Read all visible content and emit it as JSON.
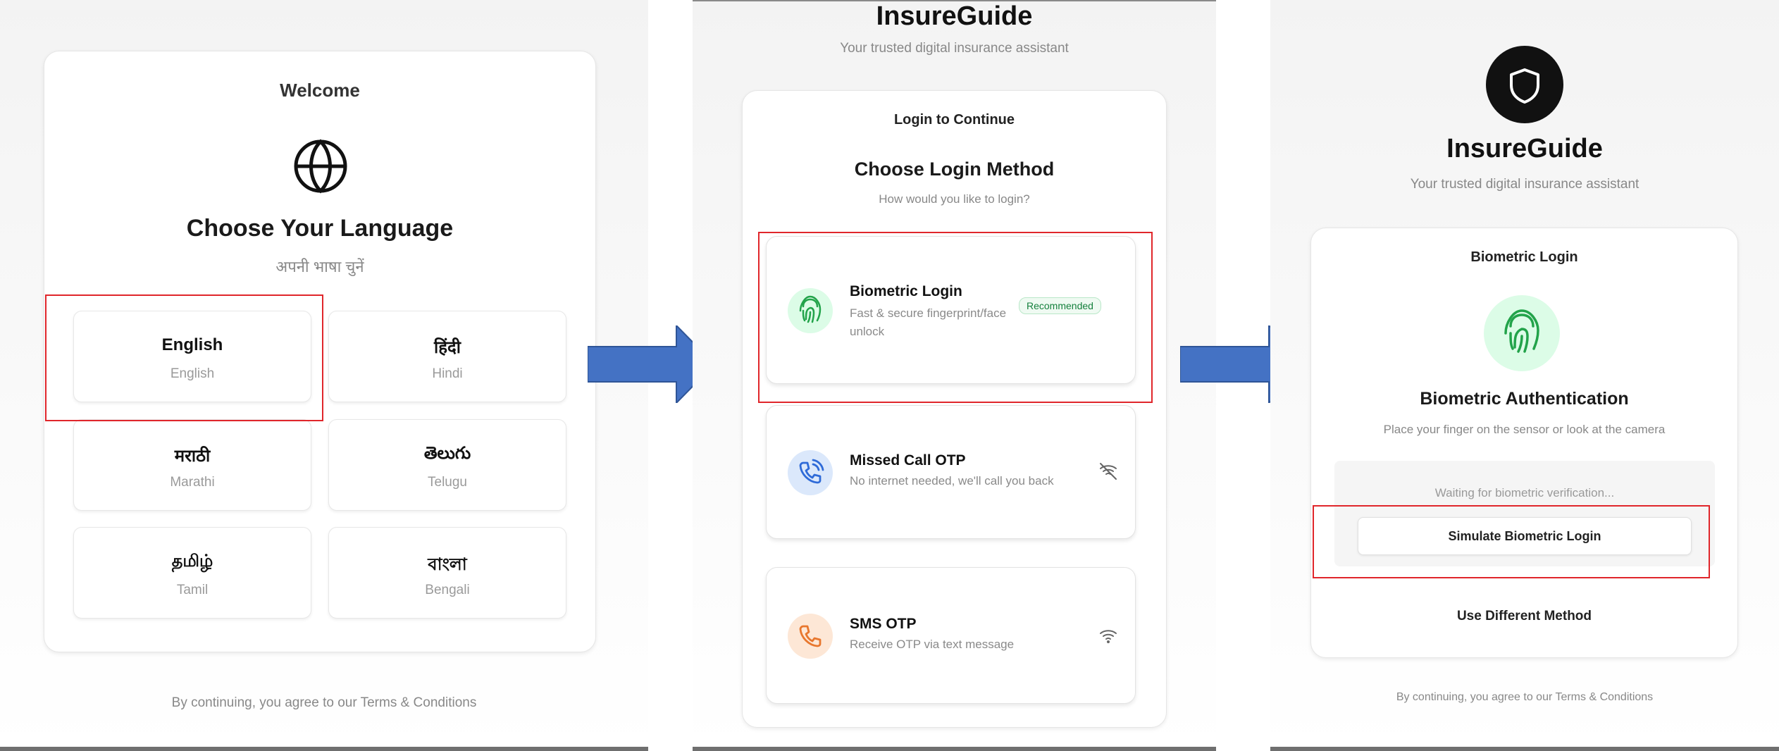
{
  "screen1": {
    "title": "Welcome",
    "heading": "Choose Your Language",
    "subheading": "अपनी भाषा चुनें",
    "icon": "globe-icon",
    "languages": [
      {
        "native": "English",
        "english": "English"
      },
      {
        "native": "हिंदी",
        "english": "Hindi"
      },
      {
        "native": "मराठी",
        "english": "Marathi"
      },
      {
        "native": "తెలుగు",
        "english": "Telugu"
      },
      {
        "native": "தமிழ்",
        "english": "Tamil"
      },
      {
        "native": "বাংলা",
        "english": "Bengali"
      }
    ],
    "terms": "By continuing, you agree to our Terms & Conditions"
  },
  "screen2": {
    "app_name": "InsureGuide",
    "tagline": "Your trusted digital insurance assistant",
    "card_title": "Login to Continue",
    "heading": "Choose Login Method",
    "subheading": "How would you like to login?",
    "options": [
      {
        "title": "Biometric Login",
        "desc": "Fast & secure fingerprint/face unlock",
        "badge": "Recommended",
        "icon": "fingerprint-icon",
        "color": "#22a34a"
      },
      {
        "title": "Missed Call OTP",
        "desc": "No internet needed, we'll call you back",
        "icon": "phone-call-icon",
        "status_icon": "wifi-off-icon",
        "color": "#2f6bd8"
      },
      {
        "title": "SMS OTP",
        "desc": "Receive OTP via text message",
        "icon": "phone-icon",
        "status_icon": "wifi-icon",
        "color": "#e8772e"
      }
    ]
  },
  "screen3": {
    "logo_icon": "shield-icon",
    "app_name": "InsureGuide",
    "tagline": "Your trusted digital insurance assistant",
    "card_title": "Biometric Login",
    "heading": "Biometric Authentication",
    "instruction": "Place your finger on the sensor or look at the camera",
    "waiting": "Waiting for biometric verification...",
    "simulate_button": "Simulate Biometric Login",
    "alt_button": "Use Different Method",
    "terms": "By continuing, you agree to our Terms & Conditions"
  },
  "colors": {
    "highlight": "#e0262b",
    "arrow": "#4472c4",
    "green_bg": "#dcfce7",
    "blue_bg": "#dbe8fb",
    "orange_bg": "#fde7d6"
  }
}
